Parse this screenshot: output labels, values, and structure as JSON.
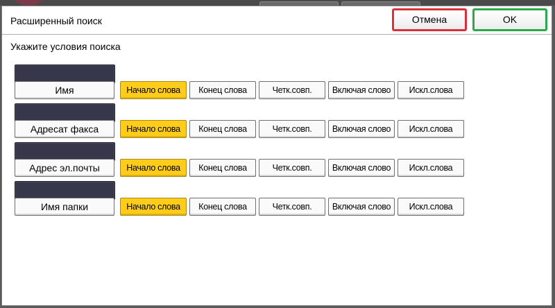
{
  "dialog": {
    "title": "Расширенный поиск",
    "cancel_label": "Отмена",
    "ok_label": "OK",
    "subtitle": "Укажите условия поиска"
  },
  "rows": [
    {
      "field_value": "",
      "field_label": "Имя",
      "options": [
        "Начало слова",
        "Конец слова",
        "Четк.совп.",
        "Включая слово",
        "Искл.слова"
      ],
      "selected": "Начало слова"
    },
    {
      "field_value": "",
      "field_label": "Адресат факса",
      "options": [
        "Начало слова",
        "Конец слова",
        "Четк.совп.",
        "Включая слово",
        "Искл.слова"
      ],
      "selected": "Начало слова"
    },
    {
      "field_value": "",
      "field_label": "Адрес эл.почты",
      "options": [
        "Начало слова",
        "Конец слова",
        "Четк.совп.",
        "Включая слово",
        "Искл.слова"
      ],
      "selected": "Начало слова"
    },
    {
      "field_value": "",
      "field_label": "Имя папки",
      "options": [
        "Начало слова",
        "Конец слова",
        "Четк.совп.",
        "Включая слово",
        "Искл.слова"
      ],
      "selected": "Начало слова"
    }
  ],
  "colors": {
    "selected_option": "#ffcc1a",
    "cancel_border": "#d9303c",
    "ok_border": "#2aa84a",
    "field_box": "#36374a"
  }
}
